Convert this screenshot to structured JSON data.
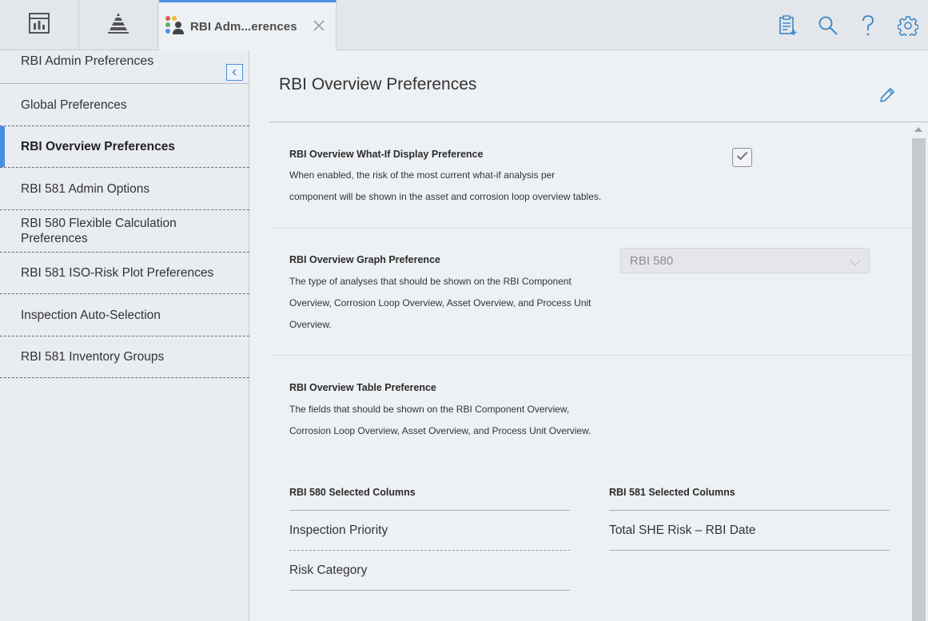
{
  "tab": {
    "label": "RBI Adm...erences"
  },
  "toolbar_icons": [
    "checklist-add-icon",
    "search-icon",
    "help-icon",
    "gear-icon"
  ],
  "sidebar": {
    "header": "RBI Admin Preferences",
    "items": [
      {
        "label": "Global Preferences"
      },
      {
        "label": "RBI Overview Preferences",
        "active": true
      },
      {
        "label": "RBI 581 Admin Options"
      },
      {
        "label": "RBI 580 Flexible Calculation Preferences"
      },
      {
        "label": "RBI 581 ISO-Risk Plot Preferences"
      },
      {
        "label": "Inspection Auto-Selection"
      },
      {
        "label": "RBI 581 Inventory Groups"
      }
    ]
  },
  "main": {
    "title": "RBI Overview Preferences",
    "whatif": {
      "title": "RBI Overview What-If Display Preference",
      "desc1": "When enabled, the risk of the most current what-if analysis per",
      "desc2": "component will be shown in the asset and corrosion loop overview tables.",
      "checked": true
    },
    "graph": {
      "title": "RBI Overview Graph Preference",
      "desc1": "The type of analyses that should be shown on the RBI Component",
      "desc2": "Overview, Corrosion Loop Overview, Asset Overview, and Process Unit",
      "desc3": "Overview.",
      "selected": "RBI 580"
    },
    "table": {
      "title": "RBI Overview Table Preference",
      "desc1": "The fields that should be shown on the RBI Component Overview,",
      "desc2": "Corrosion Loop Overview, Asset Overview, and Process Unit Overview.",
      "rbi580": {
        "header": "RBI 580 Selected Columns",
        "items": [
          "Inspection Priority",
          "Risk Category"
        ]
      },
      "rbi581": {
        "header": "RBI 581 Selected Columns",
        "items": [
          "Total SHE Risk – RBI Date"
        ]
      }
    }
  },
  "colors": {
    "accent": "#4a90e2",
    "icon": "#3a86c8"
  }
}
